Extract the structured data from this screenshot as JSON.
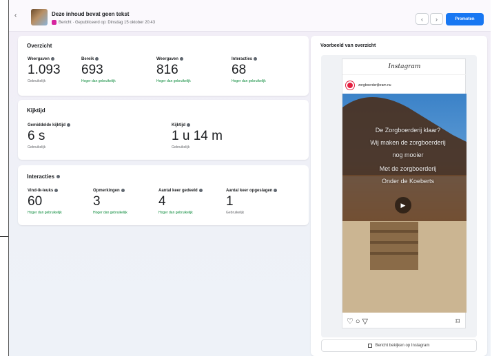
{
  "header": {
    "title": "Deze inhoud bevat geen tekst",
    "subtitle": "Bericht · Gepubliceerd op: Dinsdag 15 oktober 20:43",
    "promote_label": "Promoten"
  },
  "overview": {
    "title": "Overzicht",
    "metrics": [
      {
        "label": "Weergaven",
        "value": "1.093",
        "badge": "Gebruikelijk"
      },
      {
        "label": "Bereik",
        "value": "693",
        "badge": "Hoger dan gebruikelijk"
      },
      {
        "label": "Weergaven",
        "value": "816",
        "badge": "Hoger dan gebruikelijk"
      },
      {
        "label": "Interacties",
        "value": "68",
        "badge": "Hoger dan gebruikelijk"
      }
    ]
  },
  "watchtime": {
    "title": "Kijktijd",
    "metrics": [
      {
        "label": "Gemiddelde kijktijd",
        "value": "6 s",
        "badge": "Gebruikelijk"
      },
      {
        "label": "Kijktijd",
        "value": "1 u 14 m",
        "badge": "Gebruikelijk"
      }
    ]
  },
  "interactions": {
    "title": "Interacties",
    "metrics": [
      {
        "label": "Vind-ik-leuks",
        "value": "60",
        "badge": "Hoger dan gebruikelijk"
      },
      {
        "label": "Opmerkingen",
        "value": "3",
        "badge": "Hoger dan gebruikelijk"
      },
      {
        "label": "Aantal keer gedeeld",
        "value": "4",
        "badge": "Hoger dan gebruikelijk"
      },
      {
        "label": "Aantal keer opgeslagen",
        "value": "1",
        "badge": "Gebruikelijk"
      }
    ]
  },
  "preview": {
    "title": "Voorbeeld van overzicht",
    "platform": "Instagram",
    "account": "zorgboerderijbram.nu",
    "overlay_lines": [
      "De Zorgboerderij klaar?",
      "Wij maken de zorgboerderij",
      "nog mooier",
      "Met de zorgboerderij",
      "Onder de Koeberts"
    ],
    "view_on_instagram": "Bericht bekijken op Instagram"
  }
}
